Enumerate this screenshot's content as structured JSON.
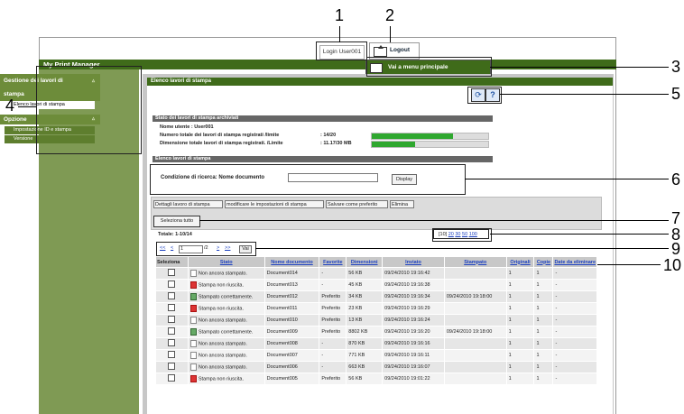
{
  "top": {
    "login_text": "Login User001",
    "logout_label": "Logout"
  },
  "header": {
    "app_title": "My Print Manager",
    "main_menu_label": "Vai a menu principale"
  },
  "sidebar": {
    "section1_line1": "Gestione dei lavori di",
    "section1_line2": "stampa",
    "section1_item": "Elenco lavori di stampa",
    "section2": "Opzione",
    "section2_item1": "Impostazione ID e stampa",
    "section2_item2": "Versione"
  },
  "main": {
    "title": "Elenco lavori di stampa",
    "archive_title": "Stato dei lavori di stampa archiviati",
    "user_line": "Nome utente : User001",
    "count_label": "Numero totale dei lavori di stampa registrati /limite",
    "count_value": ": 14/20",
    "count_progress": 0.7,
    "size_label": "Dimensione totale lavori di stampa registrati. /Limite",
    "size_value": ": 11.17/30 MB",
    "size_progress": 0.37,
    "list_title": "Elenco lavori di stampa",
    "search_label": "Condizione di ricerca:   Nome documento",
    "display_label": "Display"
  },
  "toolbar": {
    "details": "Dettagli lavoro di stampa",
    "modify": "modificare le impostazioni di stampa",
    "save_fav": "Salvare come preferito",
    "delete": "Elimina",
    "select_all": "Seleziona tutto"
  },
  "listing": {
    "total": "Totale:    1-10/14",
    "per_page_current": "[10]",
    "per_page_20": "20",
    "per_page_30": "30",
    "per_page_50": "50",
    "per_page_100": "100",
    "first": "<<",
    "prev": "<",
    "page": "1",
    "of_pages": "/2",
    "next": ">",
    "last": ">>",
    "go": "Vai"
  },
  "table": {
    "headers": [
      "Seleziona",
      "Stato",
      "Nome documento",
      "Favorite",
      "Dimensioni",
      "Inviato",
      "Stampato",
      "Originali",
      "Copie",
      "Date da eliminare"
    ],
    "rows": [
      {
        "status": "Non ancora stampato.",
        "icon": "pending",
        "doc": "Document014",
        "fav": "-",
        "size": "56 KB",
        "sent": "09/24/2010 19:16:42",
        "printed": "",
        "orig": "1",
        "copies": "1",
        "del": "-"
      },
      {
        "status": "Stampa non riuscita.",
        "icon": "fail",
        "doc": "Document013",
        "fav": "-",
        "size": "45 KB",
        "sent": "09/24/2010 19:16:38",
        "printed": "",
        "orig": "1",
        "copies": "1",
        "del": "-"
      },
      {
        "status": "Stampato correttamente.",
        "icon": "ok",
        "doc": "Document012",
        "fav": "Preferito",
        "size": "34 KB",
        "sent": "09/24/2010 19:16:34",
        "printed": "09/24/2010 19:18:00",
        "orig": "1",
        "copies": "1",
        "del": "-"
      },
      {
        "status": "Stampa non riuscita.",
        "icon": "fail",
        "doc": "Document011",
        "fav": "Preferito",
        "size": "23 KB",
        "sent": "09/24/2010 19:16:29",
        "printed": "",
        "orig": "1",
        "copies": "1",
        "del": "-"
      },
      {
        "status": "Non ancora stampato.",
        "icon": "pending",
        "doc": "Document010",
        "fav": "Preferito",
        "size": "13 KB",
        "sent": "09/24/2010 19:16:24",
        "printed": "",
        "orig": "1",
        "copies": "1",
        "del": "-"
      },
      {
        "status": "Stampato correttamente.",
        "icon": "ok",
        "doc": "Document009",
        "fav": "Preferito",
        "size": "8802 KB",
        "sent": "09/24/2010 19:16:20",
        "printed": "09/24/2010 19:18:00",
        "orig": "1",
        "copies": "1",
        "del": "-"
      },
      {
        "status": "Non ancora stampato.",
        "icon": "pending",
        "doc": "Document008",
        "fav": "-",
        "size": "870 KB",
        "sent": "09/24/2010 19:16:16",
        "printed": "",
        "orig": "1",
        "copies": "1",
        "del": "-"
      },
      {
        "status": "Non ancora stampato.",
        "icon": "pending",
        "doc": "Document007",
        "fav": "-",
        "size": "771 KB",
        "sent": "09/24/2010 19:16:11",
        "printed": "",
        "orig": "1",
        "copies": "1",
        "del": "-"
      },
      {
        "status": "Non ancora stampato.",
        "icon": "pending",
        "doc": "Document006",
        "fav": "-",
        "size": "663 KB",
        "sent": "09/24/2010 19:16:07",
        "printed": "",
        "orig": "1",
        "copies": "1",
        "del": "-"
      },
      {
        "status": "Stampa non riuscita.",
        "icon": "fail",
        "doc": "Document005",
        "fav": "Preferito",
        "size": "56 KB",
        "sent": "09/24/2010 19:01:22",
        "printed": "",
        "orig": "1",
        "copies": "1",
        "del": "-"
      }
    ]
  },
  "callouts": [
    "1",
    "2",
    "3",
    "4",
    "5",
    "6",
    "7",
    "8",
    "9",
    "10"
  ]
}
